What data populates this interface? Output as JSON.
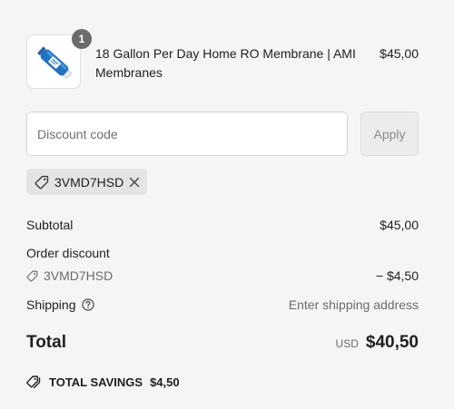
{
  "product": {
    "title": "18 Gallon Per Day Home RO Membrane | AMI Membranes",
    "price": "$45,00",
    "quantity": "1",
    "image_icon": "ro-membrane-image"
  },
  "discount": {
    "placeholder": "Discount code",
    "apply_label": "Apply",
    "applied_code": "3VMD7HSD"
  },
  "summary": {
    "subtotal_label": "Subtotal",
    "subtotal_value": "$45,00",
    "order_discount_label": "Order discount",
    "discount_code": "3VMD7HSD",
    "discount_value": "− $4,50",
    "shipping_label": "Shipping",
    "shipping_value": "Enter shipping address"
  },
  "total": {
    "label": "Total",
    "currency": "USD",
    "value": "$40,50"
  },
  "savings": {
    "label": "TOTAL SAVINGS",
    "value": "$4,50"
  },
  "colors": {
    "background": "#f5f5f5",
    "badge": "#6b6b6b",
    "tag_bg": "#e4e4e4",
    "membrane_blue": "#1f73c2"
  }
}
